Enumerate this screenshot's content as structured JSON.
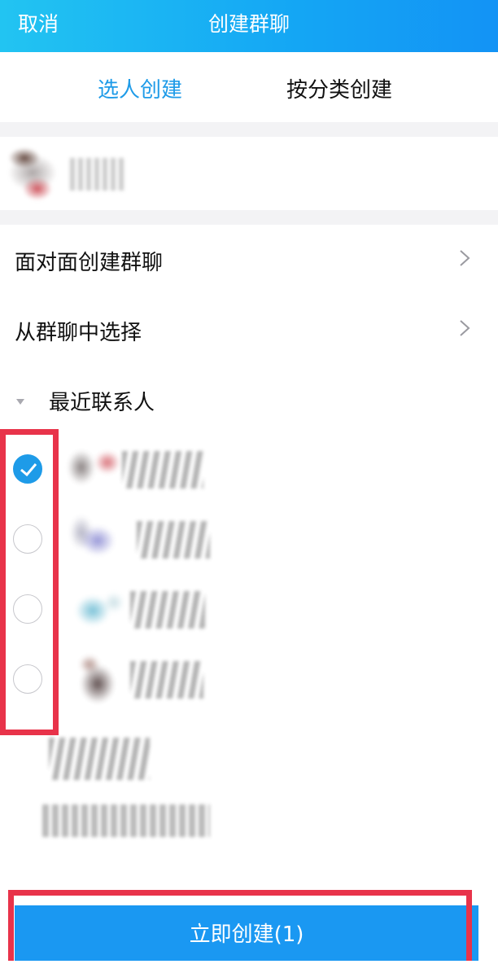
{
  "header": {
    "cancel_label": "取消",
    "title": "创建群聊"
  },
  "tabs": [
    {
      "label": "选人创建",
      "active": true
    },
    {
      "label": "按分类创建",
      "active": false
    }
  ],
  "menu": [
    {
      "label": "面对面创建群聊"
    },
    {
      "label": "从群聊中选择"
    }
  ],
  "recent": {
    "label": "最近联系人",
    "contacts": [
      {
        "checked": true
      },
      {
        "checked": false
      },
      {
        "checked": false
      },
      {
        "checked": false
      },
      {
        "checked": null
      },
      {
        "checked": null
      }
    ]
  },
  "create_button": {
    "label": "立即创建(1)"
  },
  "colors": {
    "accent": "#1e9be8",
    "header_start": "#22c4f2",
    "header_end": "#1393f5",
    "highlight": "#e8334a"
  }
}
